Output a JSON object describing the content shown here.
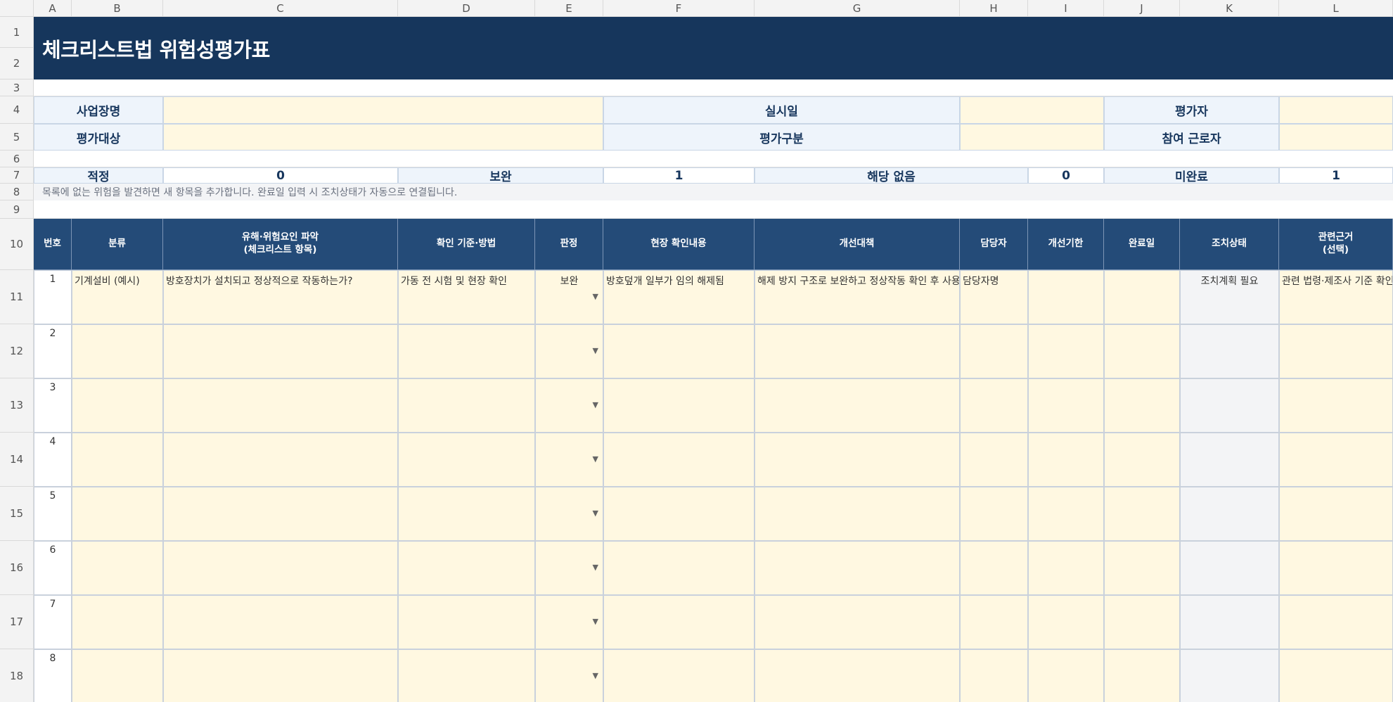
{
  "column_headers": [
    "A",
    "B",
    "C",
    "D",
    "E",
    "F",
    "G",
    "H",
    "I",
    "J",
    "K",
    "L"
  ],
  "row_headers": [
    "1",
    "2",
    "3",
    "4",
    "5",
    "6",
    "7",
    "8",
    "9",
    "10",
    "11",
    "12",
    "13",
    "14",
    "15",
    "16",
    "17",
    "18"
  ],
  "title": "체크리스트법 위험성평가표",
  "info": {
    "workplace_label": "사업장명",
    "date_label": "실시일",
    "assessor_label": "평가자",
    "target_label": "평가대상",
    "type_label": "평가구분",
    "workers_label": "참여 근로자"
  },
  "summary": {
    "adequate_label": "적정",
    "adequate_value": "0",
    "supplement_label": "보완",
    "supplement_value": "1",
    "na_label": "해당 없음",
    "na_value": "0",
    "incomplete_label": "미완료",
    "incomplete_value": "1"
  },
  "note": "목록에 없는 위험을 발견하면 새 항목을 추가합니다. 완료일 입력 시 조치상태가 자동으로 연결됩니다.",
  "table_headers": {
    "no": "번호",
    "category": "분류",
    "hazard_1": "유해·위험요인 파악",
    "hazard_2": "(체크리스트 항목)",
    "method": "확인 기준·방법",
    "judgement": "판정",
    "finding": "현장 확인내용",
    "measure": "개선대책",
    "owner": "담당자",
    "deadline": "개선기한",
    "completed": "완료일",
    "status": "조치상태",
    "basis_1": "관련근거",
    "basis_2": "(선택)"
  },
  "rows": [
    {
      "no": "1",
      "category": "기계설비 (예시)",
      "hazard": "방호장치가 설치되고 정상적으로 작동하는가?",
      "method": "가동 전 시험 및 현장 확인",
      "judgement": "보완",
      "finding": "방호덮개 일부가 임의 해제됨",
      "measure": "해제 방지 구조로 보완하고 정상작동 확인 후 사용",
      "owner": "담당자명",
      "deadline": "",
      "completed": "",
      "status": "조치계획 필요",
      "basis": "관련 법령·제조사 기준 확인"
    },
    {
      "no": "2",
      "category": "",
      "hazard": "",
      "method": "",
      "judgement": "",
      "finding": "",
      "measure": "",
      "owner": "",
      "deadline": "",
      "completed": "",
      "status": "",
      "basis": ""
    },
    {
      "no": "3",
      "category": "",
      "hazard": "",
      "method": "",
      "judgement": "",
      "finding": "",
      "measure": "",
      "owner": "",
      "deadline": "",
      "completed": "",
      "status": "",
      "basis": ""
    },
    {
      "no": "4",
      "category": "",
      "hazard": "",
      "method": "",
      "judgement": "",
      "finding": "",
      "measure": "",
      "owner": "",
      "deadline": "",
      "completed": "",
      "status": "",
      "basis": ""
    },
    {
      "no": "5",
      "category": "",
      "hazard": "",
      "method": "",
      "judgement": "",
      "finding": "",
      "measure": "",
      "owner": "",
      "deadline": "",
      "completed": "",
      "status": "",
      "basis": ""
    },
    {
      "no": "6",
      "category": "",
      "hazard": "",
      "method": "",
      "judgement": "",
      "finding": "",
      "measure": "",
      "owner": "",
      "deadline": "",
      "completed": "",
      "status": "",
      "basis": ""
    },
    {
      "no": "7",
      "category": "",
      "hazard": "",
      "method": "",
      "judgement": "",
      "finding": "",
      "measure": "",
      "owner": "",
      "deadline": "",
      "completed": "",
      "status": "",
      "basis": ""
    },
    {
      "no": "8",
      "category": "",
      "hazard": "",
      "method": "",
      "judgement": "",
      "finding": "",
      "measure": "",
      "owner": "",
      "deadline": "",
      "completed": "",
      "status": "",
      "basis": ""
    }
  ],
  "icons": {
    "dropdown": "dropdown-arrow-icon"
  },
  "colors": {
    "title_bg": "#16365c",
    "header_bg": "#244b78",
    "label_bg": "#eef4fb",
    "input_bg": "#fff8e1",
    "status_bg": "#f3f4f6"
  }
}
